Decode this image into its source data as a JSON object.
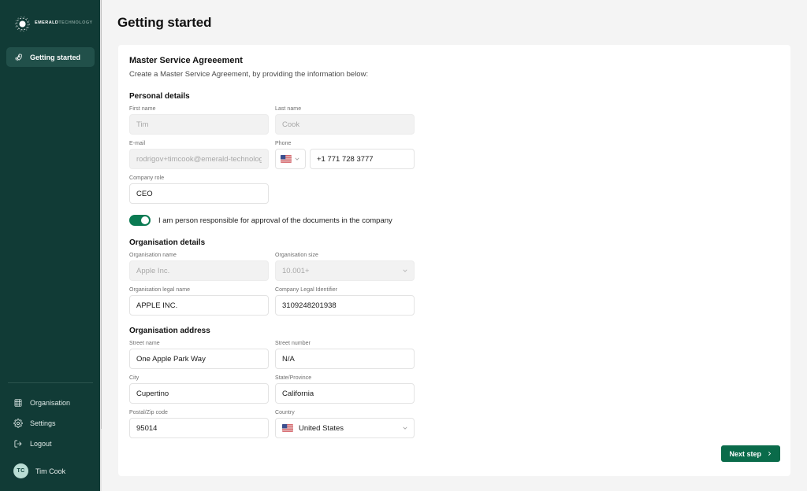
{
  "brand": {
    "name_primary": "EMERALD",
    "name_secondary": "TECHNOLOGY",
    "logo_icon": "emerald-gear-logo-icon"
  },
  "sidebar": {
    "primary_items": [
      {
        "label": "Getting started",
        "icon": "rocket-icon",
        "active": true
      }
    ],
    "secondary_items": [
      {
        "label": "Organisation",
        "icon": "building-icon"
      },
      {
        "label": "Settings",
        "icon": "gear-icon"
      },
      {
        "label": "Logout",
        "icon": "logout-icon"
      }
    ],
    "user": {
      "initials": "TC",
      "name": "Tim Cook"
    }
  },
  "header": {
    "page_title": "Getting started"
  },
  "card": {
    "section_title": "Master Service Agreeement",
    "subtitle": "Create a Master Service Agreement, by providing the information below:",
    "groups": [
      {
        "title": "Personal details",
        "fields": [
          {
            "label": "First name",
            "value": "Tim",
            "disabled": true,
            "type": "text"
          },
          {
            "label": "Last name",
            "value": "Cook",
            "disabled": true,
            "type": "text"
          },
          {
            "label": "E-mail",
            "value": "rodrigov+timcook@emerald-technology",
            "disabled": true,
            "type": "text"
          },
          {
            "label": "Phone",
            "value": "+1 771 728 3777",
            "disabled": false,
            "type": "phone",
            "country_flag": "us-flag-icon"
          },
          {
            "label": "Company role",
            "value": "CEO",
            "disabled": false,
            "type": "text"
          }
        ]
      },
      {
        "title": "Organisation details",
        "fields": [
          {
            "label": "Organisation name",
            "value": "Apple Inc.",
            "disabled": true,
            "type": "text"
          },
          {
            "label": "Organisation size",
            "value": "10.001+",
            "disabled": true,
            "type": "select"
          },
          {
            "label": "Organisation legal name",
            "value": "APPLE INC.",
            "disabled": false,
            "type": "text"
          },
          {
            "label": "Company Legal Identifier",
            "value": "3109248201938",
            "disabled": false,
            "type": "text"
          }
        ]
      },
      {
        "title": "Organisation address",
        "fields": [
          {
            "label": "Street name",
            "value": "One Apple Park Way",
            "disabled": false,
            "type": "text"
          },
          {
            "label": "Street number",
            "value": "N/A",
            "disabled": false,
            "type": "text"
          },
          {
            "label": "City",
            "value": "Cupertino",
            "disabled": false,
            "type": "text"
          },
          {
            "label": "State/Province",
            "value": "California",
            "disabled": false,
            "type": "text"
          },
          {
            "label": "Postal/Zip code",
            "value": "95014",
            "disabled": false,
            "type": "text"
          },
          {
            "label": "Country",
            "value": "United States",
            "disabled": false,
            "type": "select-flag",
            "country_flag": "us-flag-icon"
          }
        ]
      }
    ],
    "consent_toggle": {
      "label": "I am person responsible for approval of the documents in the company",
      "checked": true
    },
    "next_button": {
      "label": "Next step",
      "icon": "chevron-right-icon"
    }
  },
  "colors": {
    "sidebar_bg": "#113b36",
    "sidebar_active": "#21504a",
    "accent_green": "#0a6b4a",
    "toggle_on": "#0a7a52",
    "page_bg": "#f4f4f4",
    "card_bg": "#ffffff",
    "avatar_bg": "#b9ddd4"
  }
}
